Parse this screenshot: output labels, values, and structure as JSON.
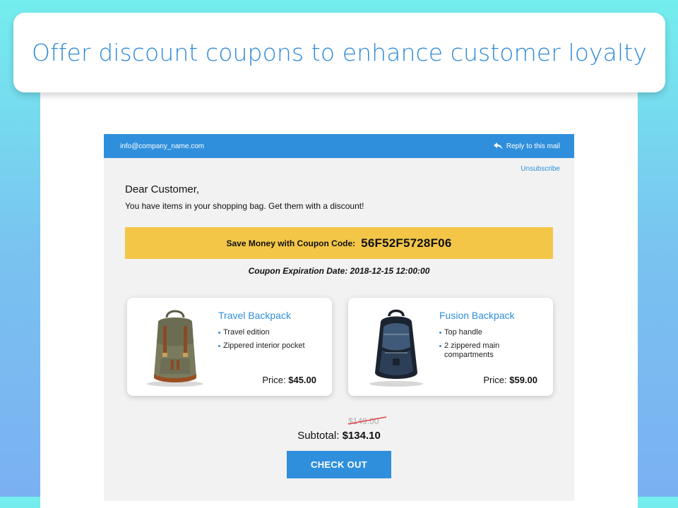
{
  "banner": {
    "title": "Offer discount coupons to enhance customer loyalty"
  },
  "email": {
    "from": "info@company_name.com",
    "reply_label": "Reply to this mail",
    "unsubscribe": "Unsubscribe",
    "greeting": "Dear Customer,",
    "intro": "You have items in your shopping bag. Get them with a discount!",
    "coupon": {
      "label": "Save Money with Coupon Code:",
      "code": "56F52F5728F06"
    },
    "expiry": "Coupon Expiration Date: 2018-12-15 12:00:00",
    "products": [
      {
        "name": "Travel Backpack",
        "features": [
          "Travel edition",
          "Zippered interior pocket"
        ],
        "price_label": "Price:",
        "price": "$45.00"
      },
      {
        "name": "Fusion Backpack",
        "features": [
          "Top handle",
          "2 zippered main compartments"
        ],
        "price_label": "Price:",
        "price": "$59.00"
      }
    ],
    "old_total": "$149.00",
    "subtotal_label": "Subtotal:",
    "subtotal": "$134.10",
    "checkout_label": "CHECK OUT"
  },
  "colors": {
    "accent": "#2f8fdc",
    "coupon_bar": "#f3c648",
    "email_background": "#f2f2f2",
    "strike": "#e0454a"
  },
  "icons": {
    "reply": "reply-arrow-icon"
  }
}
